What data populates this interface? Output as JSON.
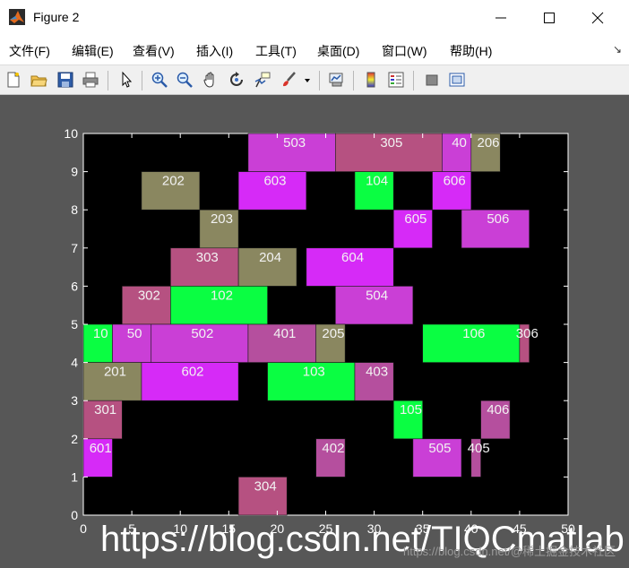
{
  "window": {
    "title": "Figure 2"
  },
  "menu": {
    "items": [
      "文件(F)",
      "编辑(E)",
      "查看(V)",
      "插入(I)",
      "工具(T)",
      "桌面(D)",
      "窗口(W)",
      "帮助(H)"
    ],
    "dock_arrow": "↘"
  },
  "toolbar": {
    "items": [
      {
        "name": "new-figure-icon"
      },
      {
        "name": "open-file-icon"
      },
      {
        "name": "save-icon"
      },
      {
        "name": "print-icon"
      },
      {
        "name": "pointer-icon"
      },
      {
        "name": "zoom-in-icon"
      },
      {
        "name": "zoom-out-icon"
      },
      {
        "name": "pan-icon"
      },
      {
        "name": "rotate-3d-icon"
      },
      {
        "name": "data-cursor-icon"
      },
      {
        "name": "brush-icon"
      },
      {
        "name": "link-plot-icon"
      },
      {
        "name": "colorbar-icon"
      },
      {
        "name": "legend-icon"
      },
      {
        "name": "hide-plot-tools-icon"
      },
      {
        "name": "show-plot-tools-icon"
      }
    ]
  },
  "watermark": {
    "url": "https://blog.csdn.net/TIQCmatlab",
    "small": "https://blog.csdn.net/@稀土掘金技术社区"
  },
  "chart_data": {
    "type": "gantt",
    "xlim": [
      0,
      50
    ],
    "ylim": [
      0,
      10
    ],
    "xticks": [
      0,
      5,
      10,
      15,
      20,
      25,
      30,
      35,
      40,
      45,
      50
    ],
    "yticks": [
      0,
      1,
      2,
      3,
      4,
      5,
      6,
      7,
      8,
      9,
      10
    ],
    "background": "#000000",
    "colors": {
      "magenta": "#d62af7",
      "purple": "#ca3fd6",
      "rose": "#b54f9e",
      "mauve": "#b65181",
      "olive": "#8a8760",
      "green": "#0afe42"
    },
    "bars": [
      {
        "label": "503",
        "x0": 17,
        "x1": 26,
        "y0": 9,
        "y1": 10,
        "color": "purple"
      },
      {
        "label": "305",
        "x0": 26,
        "x1": 37,
        "y0": 9,
        "y1": 10,
        "color": "mauve"
      },
      {
        "label": "40",
        "x0": 37,
        "x1": 40,
        "y0": 9,
        "y1": 10,
        "color": "purple"
      },
      {
        "label": "206",
        "x0": 40,
        "x1": 43,
        "y0": 9,
        "y1": 10,
        "color": "olive"
      },
      {
        "label": "202",
        "x0": 6,
        "x1": 12,
        "y0": 8,
        "y1": 9,
        "color": "olive"
      },
      {
        "label": "603",
        "x0": 16,
        "x1": 23,
        "y0": 8,
        "y1": 9,
        "color": "magenta"
      },
      {
        "label": "104",
        "x0": 28,
        "x1": 32,
        "y0": 8,
        "y1": 9,
        "color": "green"
      },
      {
        "label": "606",
        "x0": 36,
        "x1": 40,
        "y0": 8,
        "y1": 9,
        "color": "magenta"
      },
      {
        "label": "203",
        "x0": 12,
        "x1": 16,
        "y0": 7,
        "y1": 8,
        "color": "olive"
      },
      {
        "label": "605",
        "x0": 32,
        "x1": 36,
        "y0": 7,
        "y1": 8,
        "color": "magenta"
      },
      {
        "label": "506",
        "x0": 39,
        "x1": 46,
        "y0": 7,
        "y1": 8,
        "color": "purple"
      },
      {
        "label": "303",
        "x0": 9,
        "x1": 16,
        "y0": 6,
        "y1": 7,
        "color": "mauve"
      },
      {
        "label": "204",
        "x0": 16,
        "x1": 22,
        "y0": 6,
        "y1": 7,
        "color": "olive"
      },
      {
        "label": "604",
        "x0": 23,
        "x1": 32,
        "y0": 6,
        "y1": 7,
        "color": "magenta"
      },
      {
        "label": "302",
        "x0": 4,
        "x1": 9,
        "y0": 5,
        "y1": 6,
        "color": "mauve"
      },
      {
        "label": "102",
        "x0": 9,
        "x1": 19,
        "y0": 5,
        "y1": 6,
        "color": "green"
      },
      {
        "label": "504",
        "x0": 26,
        "x1": 34,
        "y0": 5,
        "y1": 6,
        "color": "purple"
      },
      {
        "label": "10",
        "x0": 0,
        "x1": 3,
        "y0": 4,
        "y1": 5,
        "color": "green"
      },
      {
        "label": "50",
        "x0": 3,
        "x1": 7,
        "y0": 4,
        "y1": 5,
        "color": "purple"
      },
      {
        "label": "502",
        "x0": 7,
        "x1": 17,
        "y0": 4,
        "y1": 5,
        "color": "purple"
      },
      {
        "label": "401",
        "x0": 17,
        "x1": 24,
        "y0": 4,
        "y1": 5,
        "color": "rose"
      },
      {
        "label": "205",
        "x0": 24,
        "x1": 27,
        "y0": 4,
        "y1": 5,
        "color": "olive"
      },
      {
        "label": "106",
        "x0": 35,
        "x1": 45,
        "y0": 4,
        "y1": 5,
        "color": "green"
      },
      {
        "label": "306",
        "x0": 45,
        "x1": 46,
        "y0": 4,
        "y1": 5,
        "color": "mauve"
      },
      {
        "label": "201",
        "x0": 0,
        "x1": 6,
        "y0": 3,
        "y1": 4,
        "color": "olive"
      },
      {
        "label": "602",
        "x0": 6,
        "x1": 16,
        "y0": 3,
        "y1": 4,
        "color": "magenta"
      },
      {
        "label": "103",
        "x0": 19,
        "x1": 28,
        "y0": 3,
        "y1": 4,
        "color": "green"
      },
      {
        "label": "403",
        "x0": 28,
        "x1": 32,
        "y0": 3,
        "y1": 4,
        "color": "rose"
      },
      {
        "label": "301",
        "x0": 0,
        "x1": 4,
        "y0": 2,
        "y1": 3,
        "color": "mauve"
      },
      {
        "label": "105",
        "x0": 32,
        "x1": 35,
        "y0": 2,
        "y1": 3,
        "color": "green"
      },
      {
        "label": "406",
        "x0": 41,
        "x1": 44,
        "y0": 2,
        "y1": 3,
        "color": "rose"
      },
      {
        "label": "601",
        "x0": 0,
        "x1": 3,
        "y0": 1,
        "y1": 2,
        "color": "magenta"
      },
      {
        "label": "402",
        "x0": 24,
        "x1": 27,
        "y0": 1,
        "y1": 2,
        "color": "rose"
      },
      {
        "label": "505",
        "x0": 34,
        "x1": 39,
        "y0": 1,
        "y1": 2,
        "color": "purple"
      },
      {
        "label": "405",
        "x0": 40,
        "x1": 41,
        "y0": 1,
        "y1": 2,
        "color": "rose"
      },
      {
        "label": "304",
        "x0": 16,
        "x1": 21,
        "y0": 0,
        "y1": 1,
        "color": "mauve"
      }
    ]
  }
}
